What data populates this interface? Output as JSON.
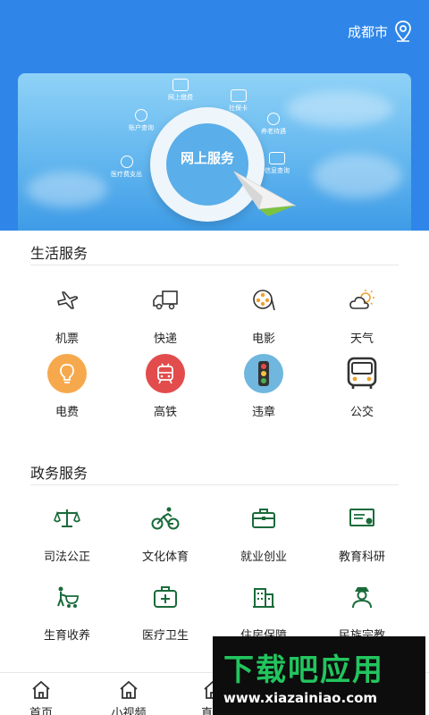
{
  "header": {
    "city": "成都市",
    "city_icon": "location-pin-icon"
  },
  "banner": {
    "center_text": "网上服务",
    "items": [
      {
        "label": "网上缴费",
        "icon": "payment-icon"
      },
      {
        "label": "社保卡",
        "icon": "card-icon"
      },
      {
        "label": "养老待遇",
        "icon": "pension-icon"
      },
      {
        "label": "信息查询",
        "icon": "info-icon"
      },
      {
        "label": "账户查询",
        "icon": "search-icon"
      },
      {
        "label": "医疗费支出",
        "icon": "medical-icon"
      }
    ]
  },
  "life": {
    "title": "生活服务",
    "items": [
      {
        "label": "机票",
        "icon": "airplane-icon"
      },
      {
        "label": "快递",
        "icon": "delivery-truck-icon"
      },
      {
        "label": "电影",
        "icon": "film-reel-icon"
      },
      {
        "label": "天气",
        "icon": "weather-icon"
      },
      {
        "label": "电费",
        "icon": "lightbulb-icon"
      },
      {
        "label": "高铁",
        "icon": "train-icon"
      },
      {
        "label": "违章",
        "icon": "traffic-light-icon"
      },
      {
        "label": "公交",
        "icon": "bus-icon"
      }
    ]
  },
  "gov": {
    "title": "政务服务",
    "items": [
      {
        "label": "司法公正",
        "icon": "scales-icon"
      },
      {
        "label": "文化体育",
        "icon": "cycling-icon"
      },
      {
        "label": "就业创业",
        "icon": "briefcase-icon"
      },
      {
        "label": "教育科研",
        "icon": "certificate-icon"
      },
      {
        "label": "生育收养",
        "icon": "stroller-icon"
      },
      {
        "label": "医疗卫生",
        "icon": "medical-kit-icon"
      },
      {
        "label": "住房保障",
        "icon": "building-icon"
      },
      {
        "label": "民族宗教",
        "icon": "person-icon"
      }
    ]
  },
  "nav": {
    "items": [
      {
        "label": "首页",
        "icon": "home-icon"
      },
      {
        "label": "小视频",
        "icon": "home-icon"
      },
      {
        "label": "直播",
        "icon": "home-icon"
      }
    ]
  },
  "watermark": {
    "title": "下载吧应用",
    "url": "www.xiazainiao.com"
  },
  "colors": {
    "header_blue": "#2f86e8",
    "gov_green": "#1a6b3a",
    "watermark_green": "#22c55e"
  }
}
